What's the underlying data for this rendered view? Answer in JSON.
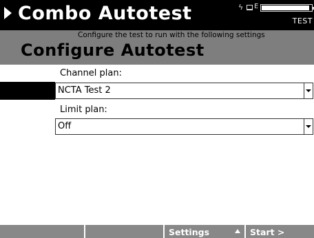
{
  "window": {
    "title": "Combo Autotest",
    "mode_label": "TEST",
    "battery_level": 0.96,
    "status_icons": [
      "charging-icon",
      "plug-icon",
      "battery-icon"
    ],
    "status_e_label": "E"
  },
  "header": {
    "instruction": "Configure the test to run with the following settings",
    "page_title": "Configure Autotest"
  },
  "form": {
    "channel_plan": {
      "label": "Channel plan:",
      "value": "NCTA Test 2"
    },
    "limit_plan": {
      "label": "Limit plan:",
      "value": "Off"
    }
  },
  "softkeys": [
    {
      "label": ""
    },
    {
      "label": ""
    },
    {
      "label": "Settings",
      "icon": "up-arrow-icon"
    },
    {
      "label": "Start >"
    }
  ]
}
